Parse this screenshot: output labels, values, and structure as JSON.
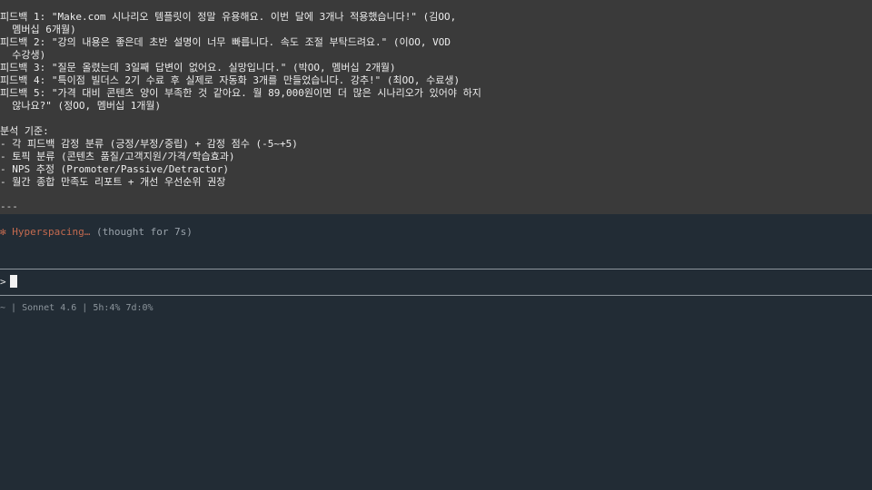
{
  "transcript": {
    "lines": [
      "피드백 1: \"Make.com 시나리오 템플릿이 정말 유용해요. 이번 달에 3개나 적용했습니다!\" (김OO,",
      "  멤버십 6개월)",
      "피드백 2: \"강의 내용은 좋은데 초반 설명이 너무 빠릅니다. 속도 조절 부탁드려요.\" (이OO, VOD",
      "  수강생)",
      "피드백 3: \"질문 올렸는데 3일째 답변이 없어요. 실망입니다.\" (박OO, 멤버십 2개월)",
      "피드백 4: \"특이점 빌더스 2기 수료 후 실제로 자동화 3개를 만들었습니다. 강추!\" (최OO, 수료생)",
      "피드백 5: \"가격 대비 콘텐츠 양이 부족한 것 같아요. 월 89,000원이면 더 많은 시나리오가 있어야 하지",
      "  않나요?\" (정OO, 멤버십 1개월)",
      "",
      "분석 기준:",
      "- 각 피드백 감정 분류 (긍정/부정/중립) + 감정 점수 (-5~+5)",
      "- 토픽 분류 (콘텐츠 품질/고객지원/가격/학습효과)",
      "- NPS 추정 (Promoter/Passive/Detractor)",
      "- 월간 종합 만족도 리포트 + 개선 우선순위 권장"
    ],
    "divider": "---"
  },
  "status": {
    "bullet": "✻",
    "word": "Hyperspacing…",
    "thought": "(thought for 7s)"
  },
  "input": {
    "prompt_symbol": ">",
    "value": ""
  },
  "footer": {
    "text": "~ | Sonnet 4.6 | 5h:4% 7d:0%"
  }
}
